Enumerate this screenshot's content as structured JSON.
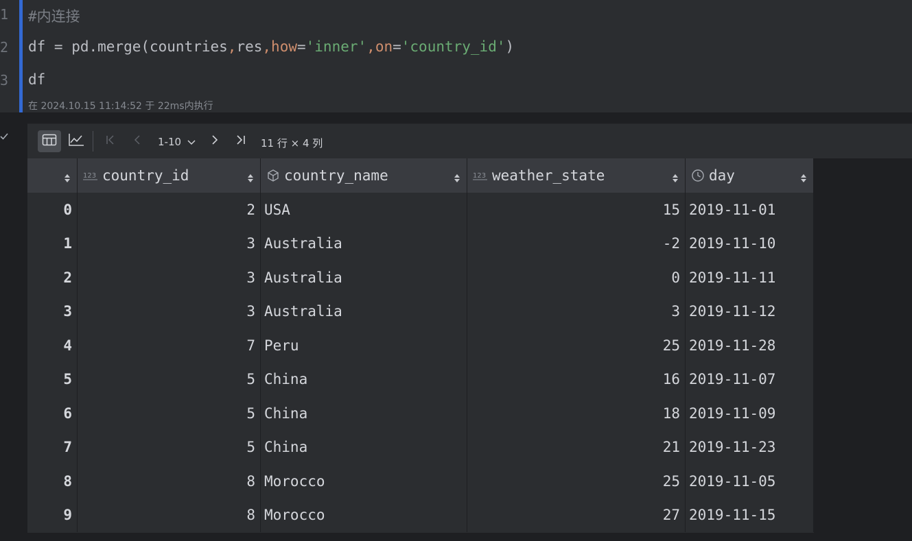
{
  "editor": {
    "line_numbers": [
      "1",
      "2",
      "3"
    ],
    "code": {
      "line1": "#内连接",
      "line2": {
        "p1": "df = pd.merge(countries",
        "c1": ",",
        "p2": "res",
        "c2": ",",
        "kw1": "how",
        "eq1": "=",
        "s1": "'inner'",
        "c3": ",",
        "kw2": "on",
        "eq2": "=",
        "s2": "'country_id'",
        "close": ")"
      },
      "line3": "df"
    },
    "exec_status": "在 2024.10.15 11:14:52 于 22ms内执行"
  },
  "output": {
    "toolbar": {
      "pagination": "1-10",
      "shape": "11 行 × 4 列"
    },
    "table": {
      "columns": [
        "country_id",
        "country_name",
        "weather_state",
        "day"
      ],
      "rows": [
        {
          "index": "0",
          "country_id": "2",
          "country_name": "USA",
          "weather_state": "15",
          "day": "2019-11-01"
        },
        {
          "index": "1",
          "country_id": "3",
          "country_name": "Australia",
          "weather_state": "-2",
          "day": "2019-11-10"
        },
        {
          "index": "2",
          "country_id": "3",
          "country_name": "Australia",
          "weather_state": "0",
          "day": "2019-11-11"
        },
        {
          "index": "3",
          "country_id": "3",
          "country_name": "Australia",
          "weather_state": "3",
          "day": "2019-11-12"
        },
        {
          "index": "4",
          "country_id": "7",
          "country_name": "Peru",
          "weather_state": "25",
          "day": "2019-11-28"
        },
        {
          "index": "5",
          "country_id": "5",
          "country_name": "China",
          "weather_state": "16",
          "day": "2019-11-07"
        },
        {
          "index": "6",
          "country_id": "5",
          "country_name": "China",
          "weather_state": "18",
          "day": "2019-11-09"
        },
        {
          "index": "7",
          "country_id": "5",
          "country_name": "China",
          "weather_state": "21",
          "day": "2019-11-23"
        },
        {
          "index": "8",
          "country_id": "8",
          "country_name": "Morocco",
          "weather_state": "25",
          "day": "2019-11-05"
        },
        {
          "index": "9",
          "country_id": "8",
          "country_name": "Morocco",
          "weather_state": "27",
          "day": "2019-11-15"
        }
      ]
    }
  },
  "colors": {
    "background": "#1e1f22",
    "panel": "#2b2d30",
    "header": "#393b40",
    "keyword": "#cf8e6d",
    "string": "#6aab73",
    "cell_marker": "#3574f0"
  }
}
